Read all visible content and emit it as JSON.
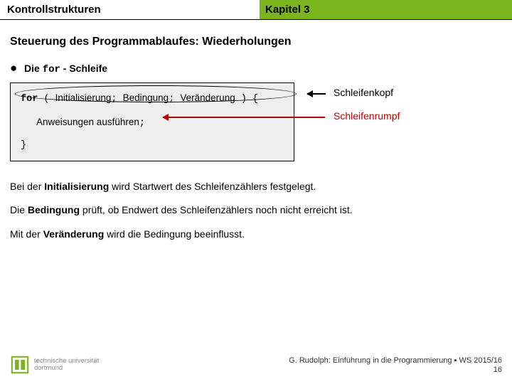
{
  "header": {
    "left": "Kontrollstrukturen",
    "right": "Kapitel 3"
  },
  "title": "Steuerung des Programmablaufes: Wiederholungen",
  "bullet": {
    "prefix": "Die ",
    "kw": "for",
    "suffix": " - Schleife"
  },
  "code": {
    "kw": "for",
    "lp": " ( ",
    "init": "Initialisierung",
    "s1": "; ",
    "cond": "Bedingung",
    "s2": "; ",
    "chg": "Veränderung",
    "rp": " ) {",
    "body": "Anweisungen ausführen",
    "semi": ";",
    "close": "}"
  },
  "labels": {
    "head": "Schleifenkopf",
    "body": "Schleifenrumpf"
  },
  "paras": {
    "p1a": "Bei der ",
    "p1b": "Initialisierung",
    "p1c": " wird Startwert des Schleifenzählers festgelegt.",
    "p2a": "Die ",
    "p2b": "Bedingung",
    "p2c": " prüft, ob Endwert des Schleifenzählers noch nicht erreicht ist.",
    "p3a": "Mit der ",
    "p3b": "Veränderung",
    "p3c": " wird die Bedingung beeinflusst."
  },
  "footer": {
    "uni1": "technische universität",
    "uni2": "dortmund",
    "credit": "G. Rudolph: Einführung in die Programmierung ▪ WS 2015/16",
    "page": "16"
  }
}
